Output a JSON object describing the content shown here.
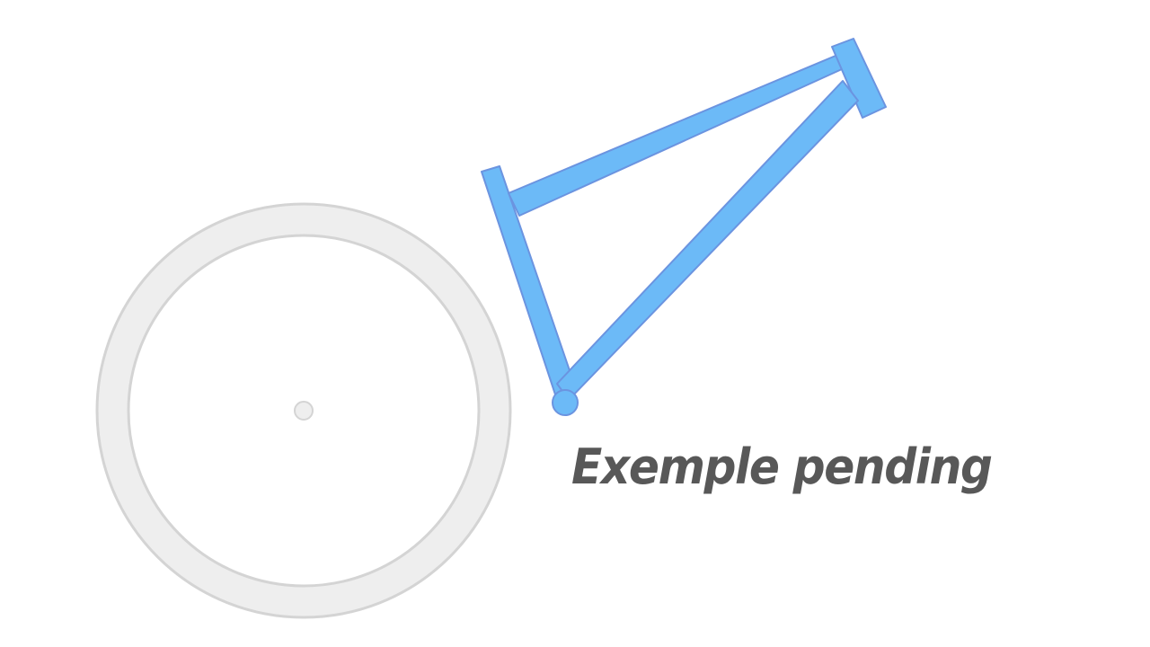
{
  "status": {
    "label": "Exemple pending"
  },
  "colors": {
    "wheel_fill": "#eeeeee",
    "wheel_stroke": "#d4d4d4",
    "frame_fill": "#6cbaf7",
    "frame_stroke": "#6b94e0",
    "label_text": "#585858"
  }
}
